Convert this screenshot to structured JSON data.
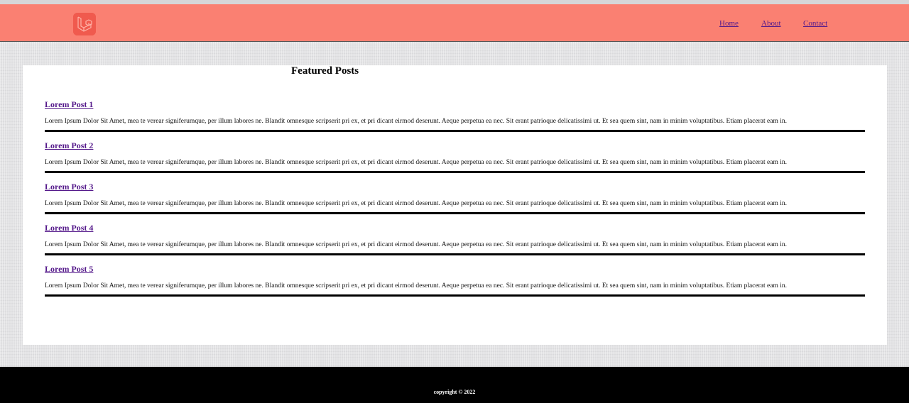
{
  "nav": {
    "home": "Home",
    "about": "About",
    "contact": "Contact"
  },
  "main": {
    "heading": "Featured Posts",
    "posts": [
      {
        "title": "Lorem Post 1",
        "text": "Lorem Ipsum Dolor Sit Amet, mea te verear signiferumque, per illum labores ne. Blandit omnesque scripserit pri ex, et pri dicant eirmod deserunt. Aeque perpetua ea nec. Sit erant patrioque delicatissimi ut. Et sea quem sint, nam in minim voluptatibus. Etiam placerat eam in."
      },
      {
        "title": "Lorem Post 2",
        "text": "Lorem Ipsum Dolor Sit Amet, mea te verear signiferumque, per illum labores ne. Blandit omnesque scripserit pri ex, et pri dicant eirmod deserunt. Aeque perpetua ea nec. Sit erant patrioque delicatissimi ut. Et sea quem sint, nam in minim voluptatibus. Etiam placerat eam in."
      },
      {
        "title": "Lorem Post 3",
        "text": "Lorem Ipsum Dolor Sit Amet, mea te verear signiferumque, per illum labores ne. Blandit omnesque scripserit pri ex, et pri dicant eirmod deserunt. Aeque perpetua ea nec. Sit erant patrioque delicatissimi ut. Et sea quem sint, nam in minim voluptatibus. Etiam placerat eam in."
      },
      {
        "title": "Lorem Post 4",
        "text": "Lorem Ipsum Dolor Sit Amet, mea te verear signiferumque, per illum labores ne. Blandit omnesque scripserit pri ex, et pri dicant eirmod deserunt. Aeque perpetua ea nec. Sit erant patrioque delicatissimi ut. Et sea quem sint, nam in minim voluptatibus. Etiam placerat eam in."
      },
      {
        "title": "Lorem Post 5",
        "text": "Lorem Ipsum Dolor Sit Amet, mea te verear signiferumque, per illum labores ne. Blandit omnesque scripserit pri ex, et pri dicant eirmod deserunt. Aeque perpetua ea nec. Sit erant patrioque delicatissimi ut. Et sea quem sint, nam in minim voluptatibus. Etiam placerat eam in."
      }
    ]
  },
  "footer": {
    "copyright": "copyright © 2022"
  },
  "colors": {
    "header_bg": "#fa8072",
    "logo_bg": "#f05a4e",
    "link": "#551a8b",
    "footer_bg": "#000000"
  },
  "icons": {
    "logo": "laravel-logo-icon"
  }
}
